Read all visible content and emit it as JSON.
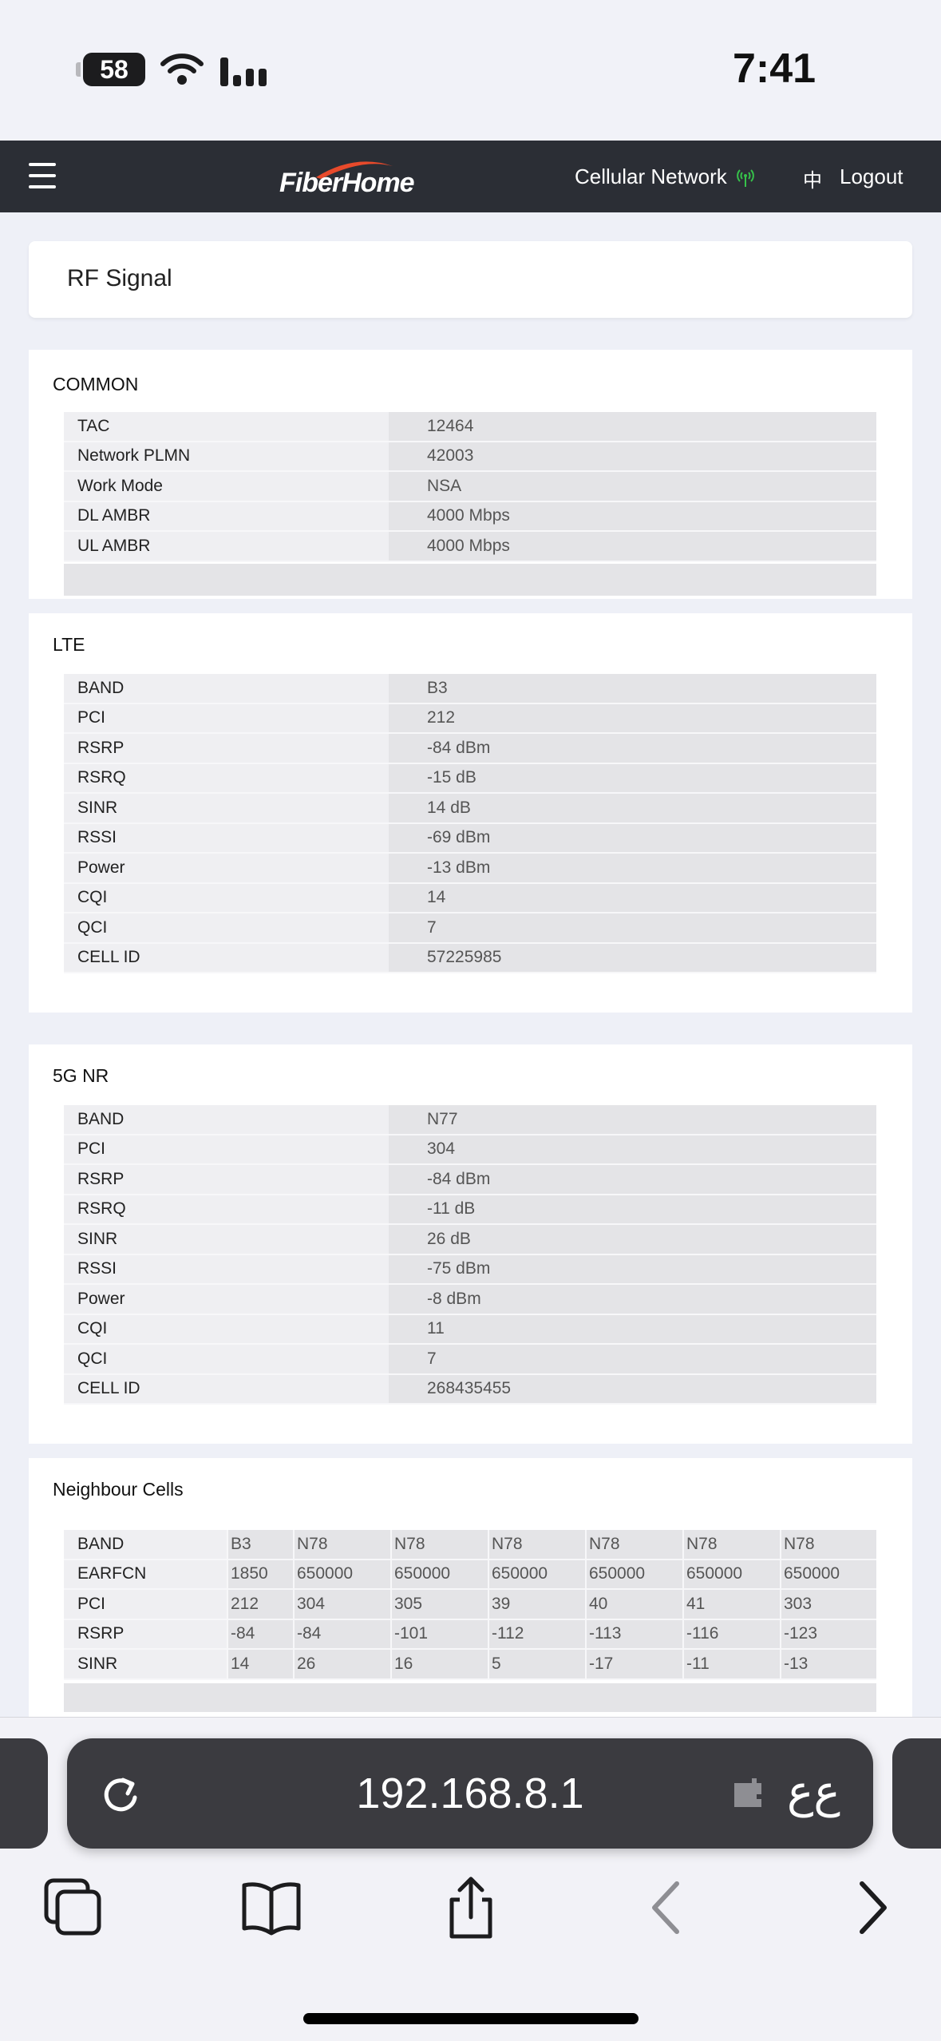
{
  "status_bar": {
    "time": "7:41",
    "battery": "58"
  },
  "header": {
    "brand": "FiberHome",
    "cellular_label": "Cellular Network",
    "lang_label": "中",
    "logout_label": "Logout",
    "accent_green": "#36c24a",
    "accent_red": "#e84a2b"
  },
  "page": {
    "title": "RF Signal"
  },
  "common": {
    "heading": "COMMON",
    "rows": [
      {
        "k": "TAC",
        "v": "12464"
      },
      {
        "k": "Network PLMN",
        "v": "42003"
      },
      {
        "k": "Work Mode",
        "v": "NSA"
      },
      {
        "k": "DL AMBR",
        "v": "4000 Mbps"
      },
      {
        "k": "UL AMBR",
        "v": "4000 Mbps"
      }
    ]
  },
  "lte": {
    "heading": "LTE",
    "rows": [
      {
        "k": "BAND",
        "v": "B3"
      },
      {
        "k": "PCI",
        "v": "212"
      },
      {
        "k": "RSRP",
        "v": "-84 dBm"
      },
      {
        "k": "RSRQ",
        "v": "-15 dB"
      },
      {
        "k": "SINR",
        "v": "14 dB"
      },
      {
        "k": "RSSI",
        "v": "-69 dBm"
      },
      {
        "k": "Power",
        "v": "-13 dBm"
      },
      {
        "k": "CQI",
        "v": "14"
      },
      {
        "k": "QCI",
        "v": "7"
      },
      {
        "k": "CELL ID",
        "v": "57225985"
      }
    ]
  },
  "nr": {
    "heading": "5G NR",
    "rows": [
      {
        "k": "BAND",
        "v": "N77"
      },
      {
        "k": "PCI",
        "v": "304"
      },
      {
        "k": "RSRP",
        "v": "-84 dBm"
      },
      {
        "k": "RSRQ",
        "v": "-11 dB"
      },
      {
        "k": "SINR",
        "v": "26 dB"
      },
      {
        "k": "RSSI",
        "v": "-75 dBm"
      },
      {
        "k": "Power",
        "v": "-8 dBm"
      },
      {
        "k": "CQI",
        "v": "11"
      },
      {
        "k": "QCI",
        "v": "7"
      },
      {
        "k": "CELL ID",
        "v": "268435455"
      }
    ]
  },
  "neighbour": {
    "heading": "Neighbour Cells",
    "rows": [
      {
        "k": "BAND",
        "cells": [
          "B3",
          "N78",
          "N78",
          "N78",
          "N78",
          "N78",
          "N78"
        ]
      },
      {
        "k": "EARFCN",
        "cells": [
          "1850",
          "650000",
          "650000",
          "650000",
          "650000",
          "650000",
          "650000"
        ]
      },
      {
        "k": "PCI",
        "cells": [
          "212",
          "304",
          "305",
          "39",
          "40",
          "41",
          "303"
        ]
      },
      {
        "k": "RSRP",
        "cells": [
          "-84",
          "-84",
          "-101",
          "-112",
          "-113",
          "-116",
          "-123"
        ]
      },
      {
        "k": "SINR",
        "cells": [
          "14",
          "26",
          "16",
          "5",
          "-17",
          "-11",
          "-13"
        ]
      }
    ]
  },
  "browser": {
    "url": "192.168.8.1",
    "text_size_label": "ﻉﻉ"
  }
}
